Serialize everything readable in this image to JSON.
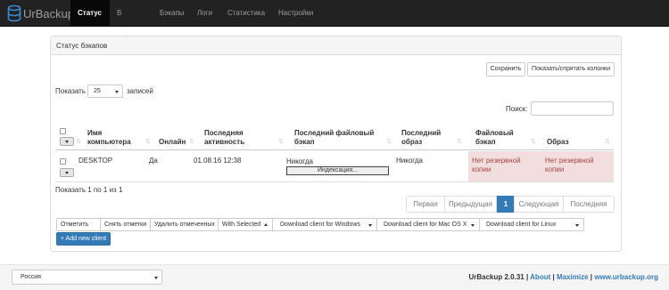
{
  "navbar": {
    "brand": "UrBackup",
    "items": [
      "Статус",
      "В работе",
      "Бэкапы",
      "Логи",
      "Статистика",
      "Настройки"
    ],
    "active_index": 0
  },
  "panel": {
    "title": "Статус бэкапов",
    "save_button": "Сохранить",
    "toggle_columns_button": "Показать/спрятать колонки",
    "show_label": "Показать",
    "page_size": "25",
    "records_label": "записей",
    "search_label": "Поиск:",
    "search_value": ""
  },
  "table": {
    "headers": {
      "computer_name": [
        "Имя",
        "компьютера"
      ],
      "online": "Онлайн",
      "last_activity": [
        "Последняя",
        "активность"
      ],
      "last_file_backup": [
        "Последний файловый",
        "бэкап"
      ],
      "last_image": [
        "Последний",
        "образ"
      ],
      "file_backup": [
        "Файловый",
        "бэкап"
      ],
      "image": "Образ"
    },
    "rows": [
      {
        "computer_name": "DESKTOP",
        "online": "Да",
        "last_activity": "01.08.16 12:38",
        "last_file_backup": "Никогда",
        "progress_label": "Индексация...",
        "last_image": "Никогда",
        "file_backup": [
          "Нет резервной",
          "копии"
        ],
        "image": [
          "Нет резервной",
          "копии"
        ]
      }
    ]
  },
  "info_text": "Показать 1 по 1 из 1",
  "pagination": [
    "Первая",
    "Предыдущая",
    "1",
    "Следующая",
    "Последняя"
  ],
  "actions": {
    "select_all": "Отметить все",
    "deselect": "Снять отметки",
    "delete_selected": "Удалить отмеченных",
    "with_selected": "With Selected",
    "download_windows": "Download client for Windows",
    "download_mac": "Download client for Mac OS X",
    "download_linux": "Download client for Linux",
    "add_client": "+ Add new client"
  },
  "footer": {
    "language": "Россия",
    "version": "UrBackup 2.0.31",
    "about": "About",
    "maximize": "Maximize",
    "website": "www.urbackup.org",
    "separator": "|"
  },
  "colors": {
    "navbar_bg": "#222222",
    "active_tab_bg": "#080808",
    "primary": "#337ab7",
    "danger_bg": "#f2dede"
  },
  "icons": {
    "brand": "database-icon",
    "dropdown": "caret-down-icon",
    "sort": "sort-arrows-icon"
  }
}
